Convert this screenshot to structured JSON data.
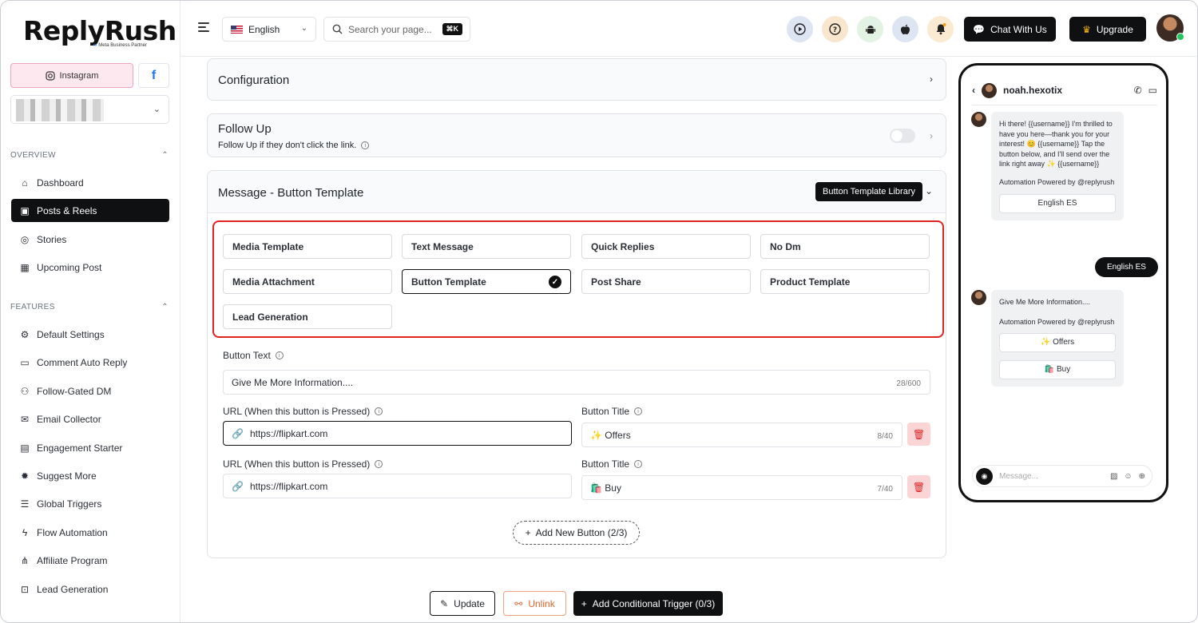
{
  "brand": {
    "name": "ReplyRush",
    "sub": "Meta Business Partner"
  },
  "accounts": {
    "instagram_label": "Instagram",
    "facebook_label": "f"
  },
  "sidebar": {
    "overview_title": "OVERVIEW",
    "features_title": "FEATURES",
    "overview_items": [
      {
        "label": "Dashboard"
      },
      {
        "label": "Posts & Reels"
      },
      {
        "label": "Stories"
      },
      {
        "label": "Upcoming Post"
      }
    ],
    "feature_items": [
      {
        "label": "Default Settings"
      },
      {
        "label": "Comment Auto Reply"
      },
      {
        "label": "Follow-Gated DM"
      },
      {
        "label": "Email Collector"
      },
      {
        "label": "Engagement Starter"
      },
      {
        "label": "Suggest More"
      },
      {
        "label": "Global Triggers"
      },
      {
        "label": "Flow Automation"
      },
      {
        "label": "Affiliate Program"
      },
      {
        "label": "Lead Generation"
      }
    ]
  },
  "topbar": {
    "language": "English",
    "search_placeholder": "Search your page...",
    "search_shortcut": "⌘K",
    "chat_label": "Chat With Us",
    "upgrade_label": "Upgrade"
  },
  "config": {
    "title": "Configuration"
  },
  "follow_up": {
    "title": "Follow Up",
    "desc": "Follow Up if they don't click the link."
  },
  "message": {
    "title": "Message - Button Template",
    "library_label": "Button Template Library",
    "templates": [
      "Media Template",
      "Text Message",
      "Quick Replies",
      "No Dm",
      "Media Attachment",
      "Button Template",
      "Post Share",
      "Product Template",
      "Lead Generation"
    ],
    "selected": "Button Template",
    "button_text_label": "Button Text",
    "button_text_value": "Give Me More Information....",
    "button_text_count": "28/600",
    "url_label": "URL (When this button is Pressed)",
    "title_label": "Button Title",
    "buttons": [
      {
        "url": "https://flipkart.com",
        "title": "✨ Offers",
        "count": "8/40"
      },
      {
        "url": "https://flipkart.com",
        "title": "🛍️ Buy",
        "count": "7/40"
      }
    ],
    "add_label": "Add New Button (2/3)"
  },
  "actions": {
    "update": "Update",
    "unlink": "Unlink",
    "conditional": "Add Conditional Trigger (0/3)"
  },
  "phone": {
    "username": "noah.hexotix",
    "msg1": "Hi there! {{username}} I'm thrilled to have you here—thank you for your interest! 😊 {{username}} Tap the button below, and I'll send over the link right away ✨ {{username}}",
    "powered": "Automation Powered by @replyrush",
    "msg1_button": "English ES",
    "reply": "English ES",
    "msg2": "Give Me More Information....",
    "msg2_buttons": [
      "✨ Offers",
      "🛍️ Buy"
    ],
    "input_placeholder": "Message..."
  },
  "colors": {
    "accent_dark": "#0f1012",
    "highlight_red": "#e02424",
    "ig_pink": "#fde8ef"
  }
}
